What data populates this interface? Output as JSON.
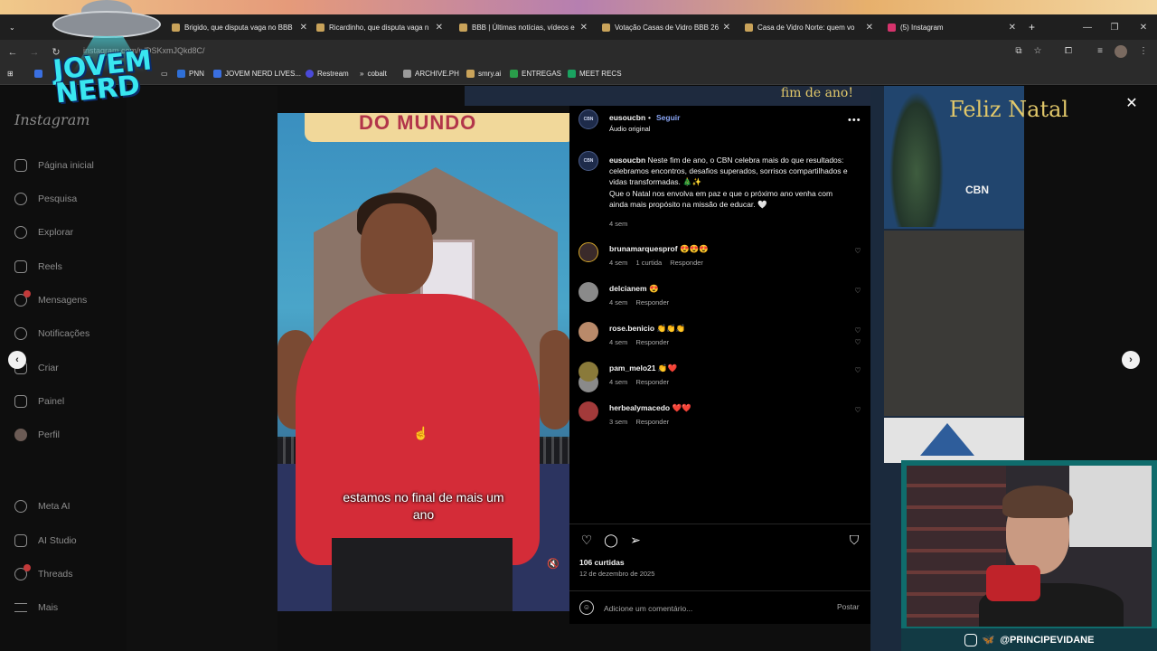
{
  "browser": {
    "tabs": [
      {
        "title": "Brigido, que disputa vaga no BBB"
      },
      {
        "title": "Ricardinho, que disputa vaga n"
      },
      {
        "title": "BBB | Últimas notícias, vídeos e"
      },
      {
        "title": "Votação Casas de Vidro BBB 26"
      },
      {
        "title": "Casa de Vidro Norte: quem vo"
      },
      {
        "title": "(5) Instagram"
      }
    ],
    "new_tab": "+",
    "url": "instagram.com/p/DSKxmJQkd8C/",
    "bookmarks": [
      {
        "label": "PNN",
        "color": "#2f6fd6"
      },
      {
        "label": "JOVEM NERD LIVES...",
        "color": "#3a6fe0"
      },
      {
        "label": "Restream",
        "color": "#4a4ad8"
      },
      {
        "label": "cobalt",
        "color": "#cfcfcf"
      },
      {
        "label": "ARCHIVE.PH",
        "color": "#9a9a9a"
      },
      {
        "label": "smry.ai",
        "color": "#c9a35a"
      },
      {
        "label": "ENTREGAS",
        "color": "#2a9d4a"
      },
      {
        "label": "MEET RECS",
        "color": "#1aa260"
      }
    ]
  },
  "sidebar": {
    "logo": "Instagram",
    "items": [
      {
        "label": "Página inicial",
        "icon": "home-icon"
      },
      {
        "label": "Pesquisa",
        "icon": "search-icon"
      },
      {
        "label": "Explorar",
        "icon": "compass-icon"
      },
      {
        "label": "Reels",
        "icon": "reels-icon"
      },
      {
        "label": "Mensagens",
        "icon": "messenger-icon",
        "badge": true
      },
      {
        "label": "Notificações",
        "icon": "heart-icon"
      },
      {
        "label": "Criar",
        "icon": "plus-icon"
      },
      {
        "label": "Painel",
        "icon": "dashboard-icon"
      },
      {
        "label": "Perfil",
        "icon": "profile-avatar-icon"
      },
      {
        "label": "Meta AI",
        "icon": "meta-ai-icon"
      },
      {
        "label": "AI Studio",
        "icon": "ai-studio-icon"
      },
      {
        "label": "Threads",
        "icon": "threads-icon",
        "badge": true
      },
      {
        "label": "Mais",
        "icon": "menu-icon"
      }
    ]
  },
  "background": {
    "right_title": "Feliz Natal",
    "right_logo": "CBN",
    "strip_text": "fim de ano!"
  },
  "video": {
    "banner": "DO MUNDO",
    "caption_line1": "estamos no final de mais um",
    "caption_line2": "ano"
  },
  "post": {
    "username": "eusoucbn",
    "separator": "•",
    "follow": "Seguir",
    "audio": "Áudio original",
    "avatar_text": "CBN",
    "caption": "Neste fim de ano, o CBN celebra mais do que resultados:\ncelebramos encontros, desafios superados, sorrisos compartilhados e vidas transformadas. 🎄✨\nQue o Natal nos envolva em paz e que o próximo ano venha com ainda mais propósito na missão de educar. 🤍",
    "caption_time": "4 sem",
    "comments": [
      {
        "user": "brunamarquesprof",
        "text": "😍😍😍",
        "time": "4 sem",
        "extra": "1 curtida",
        "reply": "Responder",
        "avatar": "#3a2a2a"
      },
      {
        "user": "delcianem",
        "text": "😍",
        "time": "4 sem",
        "extra": "",
        "reply": "Responder",
        "avatar": "#8a8a8a"
      },
      {
        "user": "rose.benicio",
        "text": "👏👏👏",
        "time": "4 sem",
        "extra": "",
        "reply": "Responder",
        "avatar": "#b98a6a"
      },
      {
        "user": "pam_melo21",
        "text": "👏❤️",
        "time": "4 sem",
        "extra": "",
        "reply": "Responder",
        "avatar": "#8a7a3a"
      },
      {
        "user": "herbealymacedo",
        "text": "❤️❤️",
        "time": "3 sem",
        "extra": "",
        "reply": "Responder",
        "avatar": "#a33a3a"
      }
    ],
    "likes": "106 curtidas",
    "date": "12 de dezembro de 2025",
    "comment_placeholder": "Adicione um comentário...",
    "post_button": "Postar"
  },
  "overlay": {
    "brand_line1": "JOVEM",
    "brand_line2": "NERD",
    "handle": "@PRINCIPEVIDANE"
  }
}
